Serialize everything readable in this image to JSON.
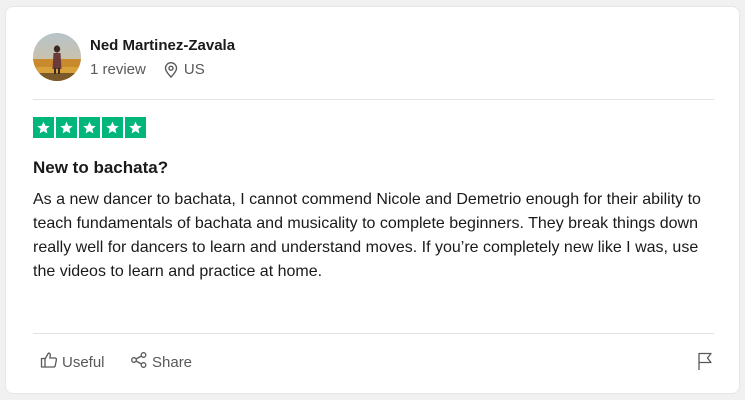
{
  "review": {
    "reviewer_name": "Ned Martinez-Zavala",
    "review_count": "1 review",
    "country": "US",
    "rating": 5,
    "title": "New to bachata?",
    "body": "As a new dancer to bachata, I cannot commend Nicole and Demetrio enough for their ability to teach fundamentals of bachata and musicality to complete beginners. They break things down really well for dancers to learn and understand moves. If you’re completely new like I was, use the videos to learn and practice at home."
  },
  "actions": {
    "useful_label": "Useful",
    "share_label": "Share"
  },
  "icons": {
    "location": "location-pin-icon",
    "star": "star-icon",
    "useful": "thumbs-up-icon",
    "share": "share-icon",
    "report": "flag-icon"
  },
  "colors": {
    "star_background": "#00b67a",
    "text_primary": "#1a1a1a",
    "text_secondary": "#595959"
  }
}
